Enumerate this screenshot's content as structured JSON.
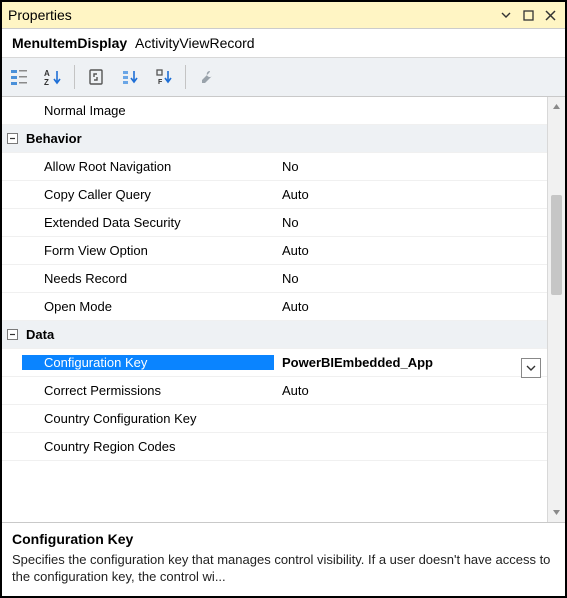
{
  "window": {
    "title": "Properties"
  },
  "object": {
    "type": "MenuItemDisplay",
    "name": "ActivityViewRecord"
  },
  "toolbar": {
    "btn_categorized": "categorized-view",
    "btn_alpha": "alphabetical-view",
    "btn_property_pages": "property-pages",
    "btn_grouped": "grouped-view",
    "btn_sort": "sort",
    "btn_wrench": "wrench"
  },
  "grid": {
    "rows": [
      {
        "kind": "prop",
        "name": "Normal Image",
        "value": ""
      },
      {
        "kind": "cat",
        "name": "Behavior"
      },
      {
        "kind": "prop",
        "name": "Allow Root Navigation",
        "value": "No"
      },
      {
        "kind": "prop",
        "name": "Copy Caller Query",
        "value": "Auto"
      },
      {
        "kind": "prop",
        "name": "Extended Data Security",
        "value": "No"
      },
      {
        "kind": "prop",
        "name": "Form View Option",
        "value": "Auto"
      },
      {
        "kind": "prop",
        "name": "Needs Record",
        "value": "No"
      },
      {
        "kind": "prop",
        "name": "Open Mode",
        "value": "Auto"
      },
      {
        "kind": "cat",
        "name": "Data"
      },
      {
        "kind": "prop",
        "name": "Configuration Key",
        "value": "PowerBIEmbedded_App",
        "selected": true,
        "dropdown": true
      },
      {
        "kind": "prop",
        "name": "Correct Permissions",
        "value": "Auto"
      },
      {
        "kind": "prop",
        "name": "Country Configuration Key",
        "value": ""
      },
      {
        "kind": "prop",
        "name": "Country Region Codes",
        "value": ""
      }
    ]
  },
  "description": {
    "name": "Configuration Key",
    "text": "Specifies the configuration key that manages control visibility. If a user doesn't have access to the configuration key, the control wi..."
  }
}
